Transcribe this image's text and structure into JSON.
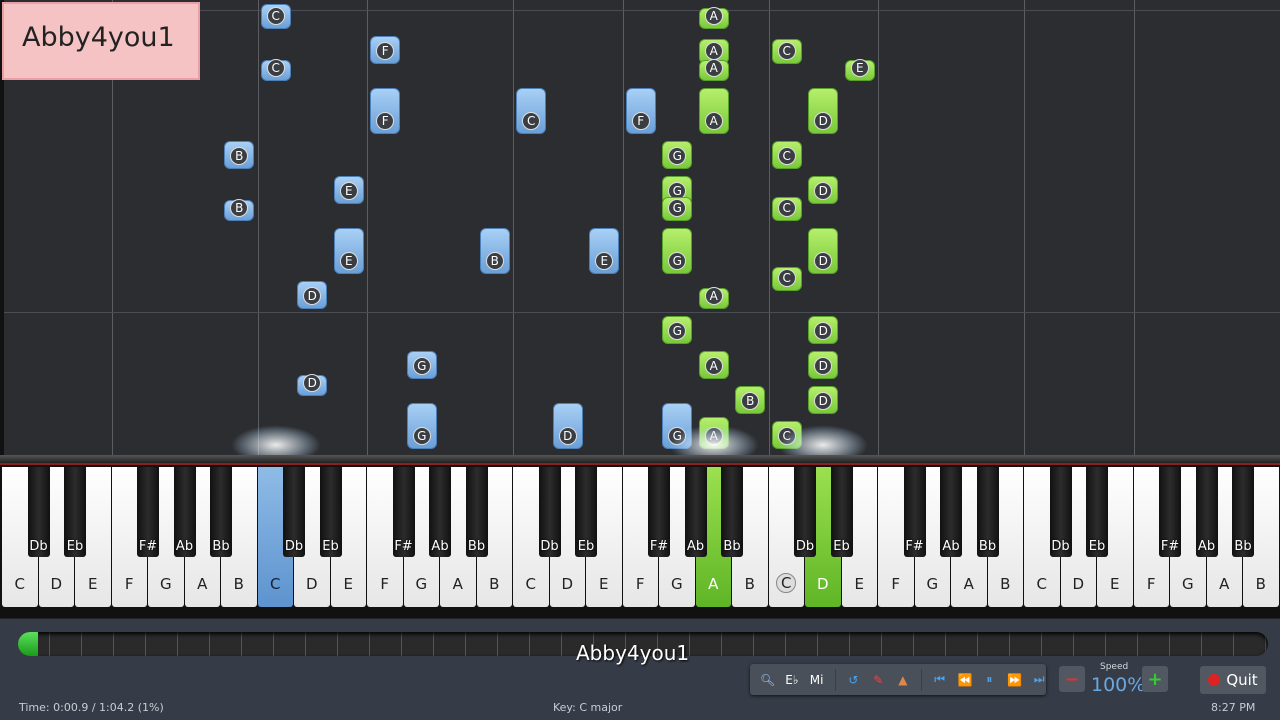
{
  "watermark": "Abby4you1",
  "keyboard": {
    "white_labels": [
      "C",
      "D",
      "E",
      "F",
      "G",
      "A",
      "B"
    ],
    "black_labels": [
      "Db",
      "Eb",
      "F#",
      "Ab",
      "Bb"
    ],
    "octaves": 5,
    "pressed_left": [
      7
    ],
    "pressed_right": [
      19,
      22
    ],
    "cue_keys": [
      21
    ]
  },
  "notes": [
    {
      "n": "C",
      "k": 7,
      "h": "l",
      "s": 12.1,
      "d": 0.7
    },
    {
      "n": "C",
      "k": 7,
      "h": "l",
      "s": 10.6,
      "d": 0.6
    },
    {
      "n": "F",
      "k": 10,
      "h": "l",
      "s": 11.1,
      "d": 0.8
    },
    {
      "n": "F",
      "k": 10,
      "h": "l",
      "s": 9.1,
      "d": 1.3
    },
    {
      "n": "B",
      "k": 6,
      "h": "l",
      "s": 8.1,
      "d": 0.8
    },
    {
      "n": "B",
      "k": 6,
      "h": "l",
      "s": 6.6,
      "d": 0.6
    },
    {
      "n": "E",
      "k": 9,
      "h": "l",
      "s": 7.1,
      "d": 0.8
    },
    {
      "n": "E",
      "k": 9,
      "h": "l",
      "s": 5.1,
      "d": 1.3
    },
    {
      "n": "D",
      "k": 8,
      "h": "l",
      "s": 4.1,
      "d": 0.8
    },
    {
      "n": "D",
      "k": 8,
      "h": "l",
      "s": 1.6,
      "d": 0.6
    },
    {
      "n": "G",
      "k": 11,
      "h": "l",
      "s": 2.1,
      "d": 0.8
    },
    {
      "n": "G",
      "k": 11,
      "h": "l",
      "s": 0.1,
      "d": 1.3
    },
    {
      "n": "B",
      "k": 13,
      "h": "l",
      "s": 5.1,
      "d": 1.3
    },
    {
      "n": "C",
      "k": 14,
      "h": "l",
      "s": 9.1,
      "d": 1.3
    },
    {
      "n": "E",
      "k": 16,
      "h": "l",
      "s": 5.1,
      "d": 1.3
    },
    {
      "n": "F",
      "k": 17,
      "h": "l",
      "s": 9.1,
      "d": 1.3
    },
    {
      "n": "D",
      "k": 15,
      "h": "l",
      "s": 0.1,
      "d": 1.3
    },
    {
      "n": "G",
      "k": 18,
      "h": "l",
      "s": 0.1,
      "d": 1.3
    },
    {
      "n": "A",
      "k": 19,
      "h": "r",
      "s": 12.1,
      "d": 0.6
    },
    {
      "n": "A",
      "k": 19,
      "h": "r",
      "s": 11.1,
      "d": 0.7
    },
    {
      "n": "A",
      "k": 19,
      "h": "r",
      "s": 10.6,
      "d": 0.6
    },
    {
      "n": "A",
      "k": 19,
      "h": "r",
      "s": 9.1,
      "d": 1.3
    },
    {
      "n": "G",
      "k": 18,
      "h": "r",
      "s": 8.1,
      "d": 0.8
    },
    {
      "n": "G",
      "k": 18,
      "h": "r",
      "s": 7.1,
      "d": 0.8
    },
    {
      "n": "G",
      "k": 18,
      "h": "r",
      "s": 6.6,
      "d": 0.7
    },
    {
      "n": "G",
      "k": 18,
      "h": "r",
      "s": 5.1,
      "d": 1.3
    },
    {
      "n": "A",
      "k": 19,
      "h": "r",
      "s": 4.1,
      "d": 0.6
    },
    {
      "n": "G",
      "k": 18,
      "h": "r",
      "s": 3.1,
      "d": 0.8
    },
    {
      "n": "A",
      "k": 19,
      "h": "r",
      "s": 2.1,
      "d": 0.8
    },
    {
      "n": "B",
      "k": 20,
      "h": "r",
      "s": 1.1,
      "d": 0.8
    },
    {
      "n": "A",
      "k": 19,
      "h": "r",
      "s": 0.1,
      "d": 0.9
    },
    {
      "n": "C",
      "k": 21,
      "h": "r",
      "s": 11.1,
      "d": 0.7
    },
    {
      "n": "C",
      "k": 21,
      "h": "r",
      "s": 8.1,
      "d": 0.8
    },
    {
      "n": "C",
      "k": 21,
      "h": "r",
      "s": 6.6,
      "d": 0.7
    },
    {
      "n": "C",
      "k": 21,
      "h": "r",
      "s": 4.6,
      "d": 0.7
    },
    {
      "n": "C",
      "k": 21,
      "h": "r",
      "s": 0.1,
      "d": 0.8
    },
    {
      "n": "D",
      "k": 22,
      "h": "r",
      "s": 9.1,
      "d": 1.3
    },
    {
      "n": "D",
      "k": 22,
      "h": "r",
      "s": 7.1,
      "d": 0.8
    },
    {
      "n": "D",
      "k": 22,
      "h": "r",
      "s": 5.1,
      "d": 1.3
    },
    {
      "n": "D",
      "k": 22,
      "h": "r",
      "s": 3.1,
      "d": 0.8
    },
    {
      "n": "D",
      "k": 22,
      "h": "r",
      "s": 2.1,
      "d": 0.8
    },
    {
      "n": "D",
      "k": 22,
      "h": "r",
      "s": 1.1,
      "d": 0.8
    },
    {
      "n": "E",
      "k": 23,
      "h": "r",
      "s": 10.6,
      "d": 0.6
    }
  ],
  "panel": {
    "progress_pct": 1,
    "signature": "Abby4you1",
    "time": "Time:  0:00.9 / 1:04.2 (1%)",
    "key": "Key: C major",
    "tools": {
      "key_label": "E♭",
      "mi_label": "Mi"
    },
    "speed_label": "Speed",
    "speed_value": "100%",
    "minus": "−",
    "plus": "+",
    "quit": "Quit",
    "clock": "8:27 PM"
  }
}
